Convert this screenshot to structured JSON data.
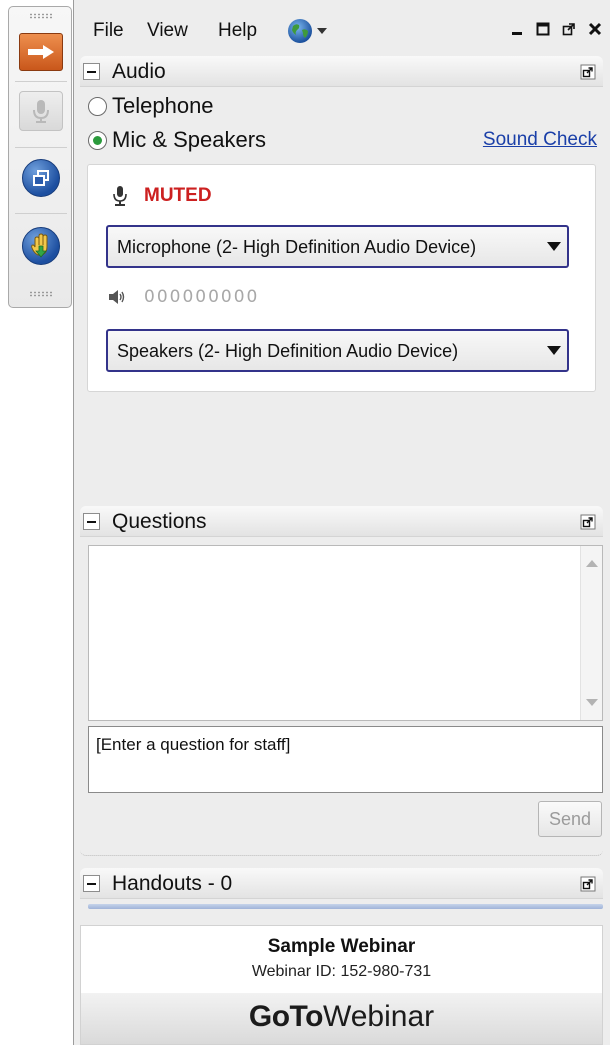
{
  "menu": {
    "file": "File",
    "view": "View",
    "help": "Help"
  },
  "audio": {
    "title": "Audio",
    "options": [
      "Telephone",
      "Mic & Speakers"
    ],
    "selected": "Mic & Speakers",
    "sound_check": "Sound Check",
    "mic_status": "MUTED",
    "microphone_device": "Microphone (2- High Definition Audio Device)",
    "speaker_level_indicator": "000000000",
    "speaker_device": "Speakers (2- High Definition Audio Device)"
  },
  "questions": {
    "title": "Questions",
    "placeholder": "[Enter a question for staff]",
    "send_label": "Send"
  },
  "handouts": {
    "title": "Handouts - 0"
  },
  "webinar": {
    "name": "Sample Webinar",
    "id_text": "Webinar ID: 152-980-731"
  },
  "brand": {
    "strong": "GoTo",
    "light": "Webinar"
  },
  "colors": {
    "muted_red": "#cc2020",
    "link_blue": "#1a3fa8",
    "accent_orange": "#d9662a",
    "radio_green": "#2b9a3c"
  },
  "icons": {
    "toolbar": [
      "arrow-right-icon",
      "microphone-icon",
      "restore-window-icon",
      "raise-hand-icon"
    ],
    "window": [
      "minimize-icon",
      "maximize-icon",
      "popout-icon",
      "close-icon"
    ]
  }
}
